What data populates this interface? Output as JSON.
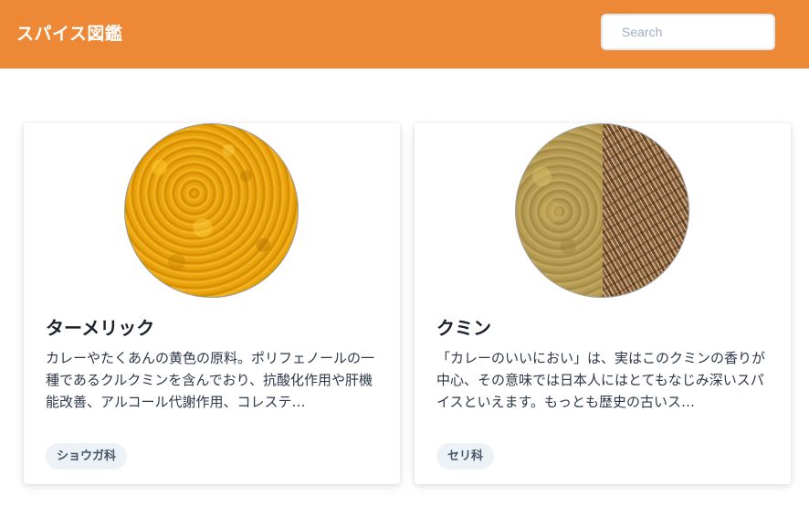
{
  "header": {
    "title": "スパイス図鑑",
    "search_placeholder": "Search",
    "background_color": "#ed8936"
  },
  "spices": [
    {
      "name": "ターメリック",
      "description": "カレーやたくあんの黄色の原料。ポリフェノールの一種であるクルクミンを含んでおり、抗酸化作用や肝機能改善、アルコール代謝作用、コレステ…",
      "family": "ショウガ科",
      "image": "turmeric-powder"
    },
    {
      "name": "クミン",
      "description": "「カレーのいいにおい」は、実はこのクミンの香りが中心、その意味では日本人にはとてもなじみ深いスパイスといえます。もっとも歴史の古いス…",
      "family": "セリ科",
      "image": "cumin-powder-and-seeds"
    }
  ]
}
